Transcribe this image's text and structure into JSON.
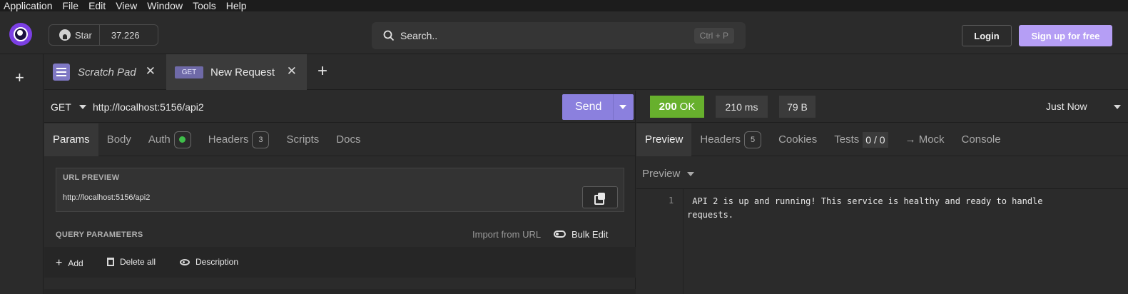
{
  "menu": [
    "Application",
    "File",
    "Edit",
    "View",
    "Window",
    "Tools",
    "Help"
  ],
  "header": {
    "star_label": "Star",
    "star_count": "37.226",
    "search_placeholder": "Search..",
    "search_shortcut": "Ctrl + P",
    "login_label": "Login",
    "signup_label": "Sign up for free",
    "signup_color": "#b59ef5"
  },
  "tabs": [
    {
      "label": "Scratch Pad"
    },
    {
      "method": "GET",
      "label": "New Request"
    }
  ],
  "request": {
    "method": "GET",
    "url": "http://localhost:5156/api2",
    "send_label": "Send",
    "subtabs": [
      "Params",
      "Body",
      "Auth",
      "Headers",
      "Scripts",
      "Docs"
    ],
    "headers_count": "3",
    "url_preview_title": "URL PREVIEW",
    "url_preview_value": "http://localhost:5156/api2",
    "query_title": "QUERY PARAMETERS",
    "import_label": "Import from URL",
    "bulk_edit_label": "Bulk Edit",
    "add_label": "Add",
    "delete_all_label": "Delete all",
    "description_label": "Description"
  },
  "response": {
    "status_code": "200",
    "status_text": "OK",
    "status_color": "#67b02d",
    "time": "210 ms",
    "size": "79 B",
    "history": "Just Now",
    "tabs": [
      "Preview",
      "Headers",
      "Cookies",
      "Tests",
      "→ Mock",
      "Console"
    ],
    "headers_count": "5",
    "tests": "0 / 0",
    "preview_mode": "Preview",
    "line_number": "1",
    "body": " API 2 is up and running! This service is healthy and ready to handle\nrequests."
  }
}
